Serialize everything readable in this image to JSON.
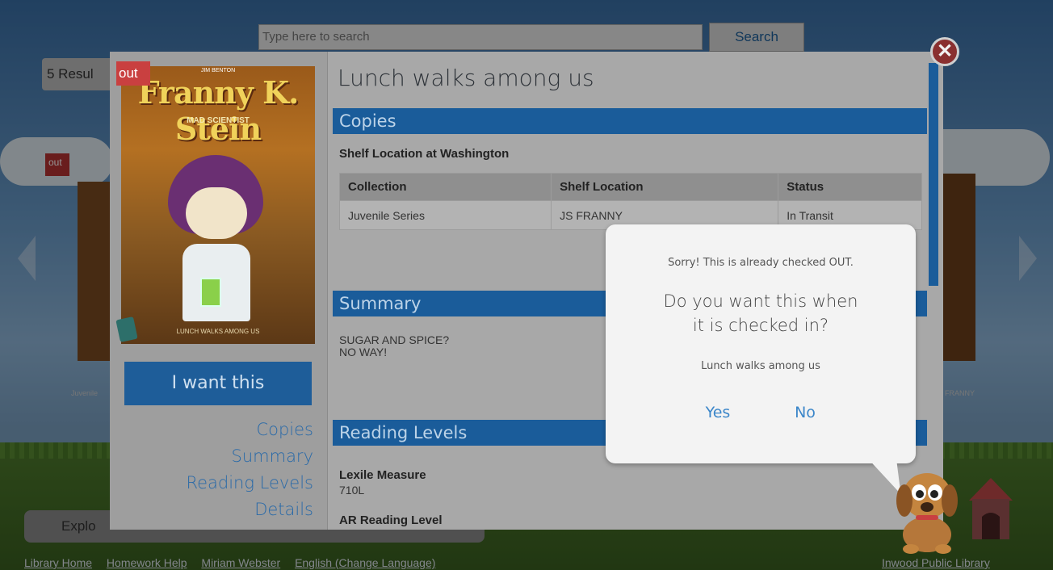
{
  "search": {
    "placeholder": "Type here to search",
    "button_label": "Search"
  },
  "results": {
    "count_label": "5 Resul"
  },
  "background": {
    "out_label": "out",
    "caption_left": "Juvenile",
    "caption_right": "FRANNY",
    "explore_label": "Explo"
  },
  "footer": {
    "links": [
      "Library Home",
      "Homework Help",
      "Miriam Webster",
      "English (Change Language)"
    ],
    "library_name": "Inwood Public Library"
  },
  "modal": {
    "out_tag": "out",
    "cover": {
      "author": "JIM BENTON",
      "title": "Franny K. Stein",
      "subtitle": "MAD SCIENTIST",
      "footer": "LUNCH WALKS AMONG US"
    },
    "want_button": "I want this",
    "side_nav": [
      "Copies",
      "Summary",
      "Reading Levels",
      "Details"
    ],
    "title": "Lunch walks among us",
    "copies": {
      "header": "Copies",
      "shelf_location": "Shelf Location at Washington",
      "columns": [
        "Collection",
        "Shelf Location",
        "Status"
      ],
      "rows": [
        [
          "Juvenile Series",
          "JS FRANNY",
          "In Transit"
        ]
      ]
    },
    "summary": {
      "header": "Summary",
      "line1": "SUGAR AND SPICE?",
      "line2": "NO WAY!"
    },
    "reading_levels": {
      "header": "Reading Levels",
      "lexile_label": "Lexile Measure",
      "lexile_value": "710L",
      "ar_label": "AR Reading Level"
    },
    "close_glyph": "✕"
  },
  "dialog": {
    "sorry": "Sorry! This is already checked OUT.",
    "question_line1": "Do you want this when",
    "question_line2": "it is checked in?",
    "book_title": "Lunch walks among us",
    "yes": "Yes",
    "no": "No"
  },
  "colors": {
    "accent_blue": "#1a5c9a",
    "out_red": "#c94040",
    "link_blue": "#3b86c9"
  }
}
